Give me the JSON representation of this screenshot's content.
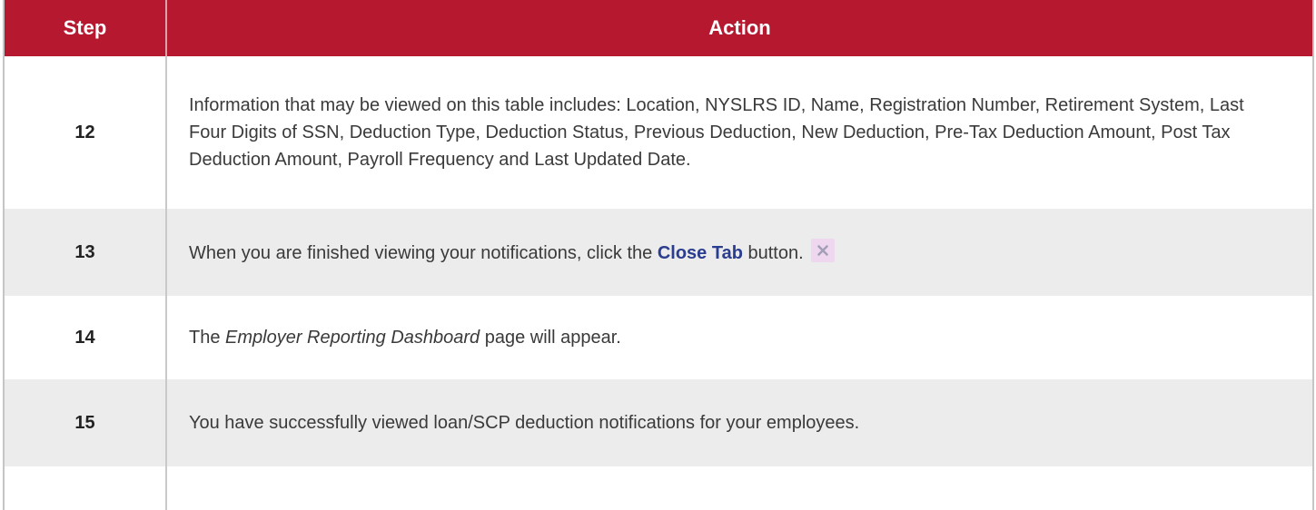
{
  "table": {
    "headers": {
      "step": "Step",
      "action": "Action"
    },
    "rows": [
      {
        "step": "12",
        "text": "Information that may be viewed on this table includes: Location, NYSLRS ID, Name, Registration Number, Retirement System, Last Four Digits of SSN, Deduction Type, Deduction Status, Previous Deduction, New Deduction, Pre-Tax Deduction Amount, Post Tax Deduction Amount, Payroll Frequency and Last Updated Date."
      },
      {
        "step": "13",
        "text_before": "When you are finished viewing your notifications, click the ",
        "emphasis": "Close Tab",
        "text_after": " button.",
        "icon": "close-icon"
      },
      {
        "step": "14",
        "text_before": "The ",
        "emphasis": "Employer Reporting Dashboard",
        "text_after": " page will appear."
      },
      {
        "step": "15",
        "text": "You have successfully viewed loan/SCP deduction notifications for your employees."
      }
    ]
  },
  "colors": {
    "header_bg": "#b5182f",
    "header_text": "#ffffff",
    "alt_row_bg": "#ececec",
    "link_blue": "#2b3d8f"
  }
}
